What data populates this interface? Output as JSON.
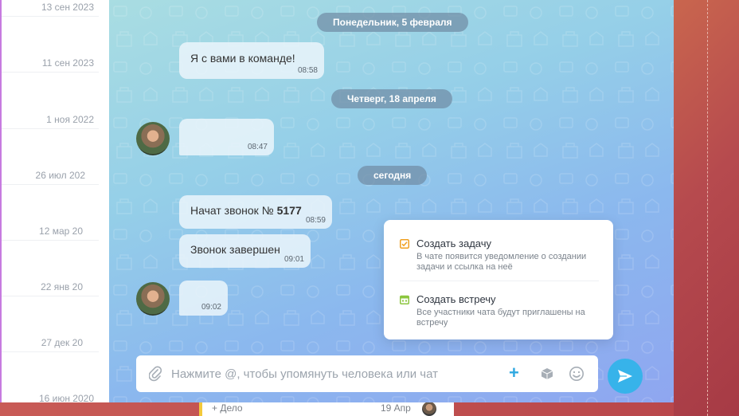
{
  "left_list": {
    "dates": [
      "13 сен 2023",
      "11 сен 2023",
      "1 ноя 2022",
      "26 июл 202",
      "12 мар 20",
      "22 янв 20",
      "27 дек 20",
      "16 июн 2020"
    ]
  },
  "chat": {
    "separators": [
      "Понедельник, 5 февраля",
      "Четверг, 18 апреля",
      "сегодня"
    ],
    "messages": [
      {
        "text": "Я с вами в команде!",
        "time": "08:58"
      },
      {
        "text": "",
        "time": "08:47"
      },
      {
        "text": "Начат звонок № ",
        "number": "5177",
        "time": "08:59"
      },
      {
        "text": "Звонок завершен",
        "time": "09:01"
      },
      {
        "text": "",
        "time": "09:02"
      }
    ]
  },
  "popup": {
    "items": [
      {
        "title": "Создать задачу",
        "description": "В чате появится уведомление о создании задачи и ссылка на неё",
        "icon": "task-checkbox-icon",
        "color": "#f0a020"
      },
      {
        "title": "Создать встречу",
        "description": "Все участники чата будут приглашены на встречу",
        "icon": "calendar-icon",
        "color": "#8cc63f"
      }
    ]
  },
  "composer": {
    "placeholder": "Нажмите @, чтобы упомянуть человека или чат",
    "accent": "#37b3ea"
  },
  "bottom_strip": {
    "task": "+ Дело",
    "date": "19 Апр"
  }
}
